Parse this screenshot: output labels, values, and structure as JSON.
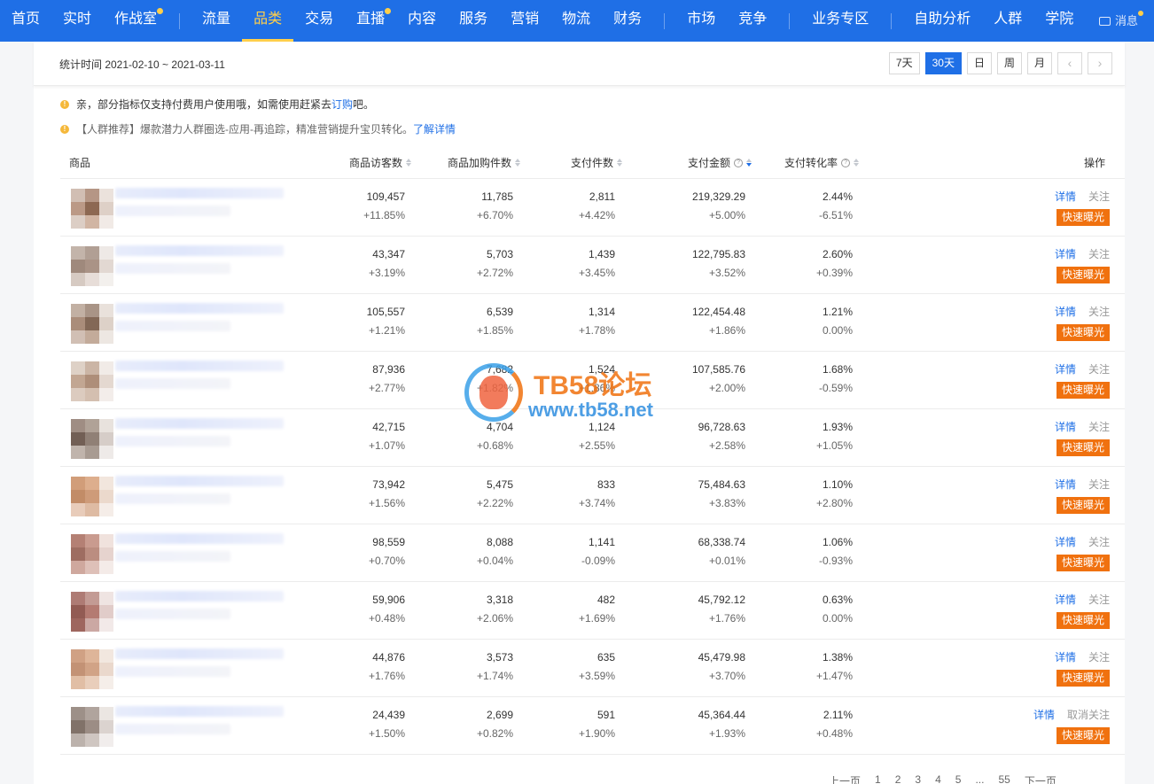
{
  "nav": {
    "items": [
      {
        "label": "首页",
        "dot": false,
        "active": false
      },
      {
        "label": "实时",
        "dot": false,
        "active": false
      },
      {
        "label": "作战室",
        "dot": true,
        "active": false
      },
      {
        "sep": true
      },
      {
        "label": "流量",
        "dot": false,
        "active": false
      },
      {
        "label": "品类",
        "dot": false,
        "active": true
      },
      {
        "label": "交易",
        "dot": false,
        "active": false
      },
      {
        "label": "直播",
        "dot": true,
        "active": false
      },
      {
        "label": "内容",
        "dot": false,
        "active": false
      },
      {
        "label": "服务",
        "dot": false,
        "active": false
      },
      {
        "label": "营销",
        "dot": false,
        "active": false
      },
      {
        "label": "物流",
        "dot": false,
        "active": false
      },
      {
        "label": "财务",
        "dot": false,
        "active": false
      },
      {
        "sep": true
      },
      {
        "label": "市场",
        "dot": false,
        "active": false
      },
      {
        "label": "竞争",
        "dot": false,
        "active": false
      },
      {
        "sep": true
      },
      {
        "label": "业务专区",
        "dot": false,
        "active": false
      },
      {
        "sep": true
      },
      {
        "label": "自助分析",
        "dot": false,
        "active": false
      },
      {
        "label": "人群",
        "dot": false,
        "active": false
      },
      {
        "label": "学院",
        "dot": false,
        "active": false
      }
    ],
    "message_label": "消息",
    "message_icon": "envelope-icon"
  },
  "stat": {
    "label": "统计时间 2021-02-10 ~ 2021-03-11",
    "ranges": [
      "7天",
      "30天",
      "日",
      "周",
      "月"
    ],
    "active_range": "30天",
    "prev_icon": "‹",
    "next_icon": "›"
  },
  "notices": {
    "n1_text": "亲，部分指标仅支持付费用户使用哦，如需使用赶紧去",
    "n1_link": "订购",
    "n1_tail": "吧。",
    "n2_text": "【人群推荐】爆款潜力人群圈选-应用-再追踪，精准营销提升宝贝转化。",
    "n2_link": "了解详情"
  },
  "table": {
    "headers": {
      "product": "商品",
      "visitors": "商品访客数",
      "cart": "商品加购件数",
      "paid_items": "支付件数",
      "paid_amount": "支付金额",
      "conversion": "支付转化率",
      "ops": "操作"
    },
    "op_detail": "详情",
    "op_expose": "快速曝光",
    "rows": [
      {
        "visitors": "109,457",
        "visitors_chg": "+11.85%",
        "cart": "11,785",
        "cart_chg": "+6.70%",
        "paid": "2,811",
        "paid_chg": "+4.42%",
        "amount": "219,329.29",
        "amount_chg": "+5.00%",
        "conv": "2.44%",
        "conv_chg": "-6.51%",
        "follow": "关注",
        "colors": [
          "#c9b3a6",
          "#a98470",
          "#e8ddd6",
          "#b08872",
          "#7a4e35",
          "#d9c8be",
          "#d6c6bb",
          "#c9a994",
          "#efe7e2"
        ]
      },
      {
        "visitors": "43,347",
        "visitors_chg": "+3.19%",
        "cart": "5,703",
        "cart_chg": "+2.72%",
        "paid": "1,439",
        "paid_chg": "+3.45%",
        "amount": "122,795.83",
        "amount_chg": "+3.52%",
        "conv": "2.60%",
        "conv_chg": "+0.39%",
        "follow": "关注",
        "colors": [
          "#b9a79c",
          "#a48f82",
          "#ece6e2",
          "#8f7566",
          "#9c8172",
          "#ddd2cb",
          "#cfc1b8",
          "#e3d8d2",
          "#f2eeeb"
        ]
      },
      {
        "visitors": "105,557",
        "visitors_chg": "+1.21%",
        "cart": "6,539",
        "cart_chg": "+1.85%",
        "paid": "1,314",
        "paid_chg": "+1.78%",
        "amount": "122,454.48",
        "amount_chg": "+1.86%",
        "conv": "1.21%",
        "conv_chg": "0.00%",
        "follow": "关注",
        "colors": [
          "#b8a393",
          "#9b8271",
          "#e6dcd5",
          "#9c7a63",
          "#6e4e39",
          "#d8c9bf",
          "#c9b5a7",
          "#b99d89",
          "#ebe3de"
        ]
      },
      {
        "visitors": "87,936",
        "visitors_chg": "+2.77%",
        "cart": "7,682",
        "cart_chg": "+1.82%",
        "paid": "1,524",
        "paid_chg": "+1.86%",
        "amount": "107,585.76",
        "amount_chg": "+2.00%",
        "conv": "1.68%",
        "conv_chg": "-0.59%",
        "follow": "关注",
        "colors": [
          "#d9c9bd",
          "#c3a996",
          "#efe8e3",
          "#b8977f",
          "#a07b62",
          "#e0d2c8",
          "#d6c3b5",
          "#cdb5a3",
          "#f1ebe7"
        ]
      },
      {
        "visitors": "42,715",
        "visitors_chg": "+1.07%",
        "cart": "4,704",
        "cart_chg": "+0.68%",
        "paid": "1,124",
        "paid_chg": "+2.55%",
        "amount": "96,728.63",
        "amount_chg": "+2.58%",
        "conv": "1.93%",
        "conv_chg": "+1.05%",
        "follow": "关注",
        "colors": [
          "#8f7a6e",
          "#a39286",
          "#e4ddd8",
          "#5a4438",
          "#7d6a5f",
          "#cfc5bf",
          "#b6a79e",
          "#9a8a80",
          "#ece7e4"
        ]
      },
      {
        "visitors": "73,942",
        "visitors_chg": "+1.56%",
        "cart": "5,475",
        "cart_chg": "+2.22%",
        "paid": "833",
        "paid_chg": "+3.74%",
        "amount": "75,484.63",
        "amount_chg": "+3.83%",
        "conv": "1.10%",
        "conv_chg": "+2.80%",
        "follow": "关注",
        "colors": [
          "#c98d62",
          "#d8a17a",
          "#f0e2d8",
          "#b8784d",
          "#c68a62",
          "#e8d3c4",
          "#e4c4ae",
          "#d9b093",
          "#f4ebe5"
        ]
      },
      {
        "visitors": "98,559",
        "visitors_chg": "+0.70%",
        "cart": "8,088",
        "cart_chg": "+0.04%",
        "paid": "1,141",
        "paid_chg": "-0.09%",
        "amount": "68,338.74",
        "amount_chg": "+0.01%",
        "conv": "1.06%",
        "conv_chg": "-0.93%",
        "follow": "关注",
        "colors": [
          "#a86a5c",
          "#c08a7c",
          "#eeddd8",
          "#8e5446",
          "#b07a6b",
          "#e2ccc6",
          "#c79a8e",
          "#d9b6ac",
          "#f3e8e5"
        ]
      },
      {
        "visitors": "59,906",
        "visitors_chg": "+0.48%",
        "cart": "3,318",
        "cart_chg": "+2.06%",
        "paid": "482",
        "paid_chg": "+1.69%",
        "amount": "45,792.12",
        "amount_chg": "+1.76%",
        "conv": "0.63%",
        "conv_chg": "0.00%",
        "follow": "关注",
        "colors": [
          "#a0655c",
          "#b98a82",
          "#ede0dd",
          "#7f3f36",
          "#a8645a",
          "#dcc4c0",
          "#8e4c43",
          "#c29a93",
          "#f0e6e4"
        ]
      },
      {
        "visitors": "44,876",
        "visitors_chg": "+1.76%",
        "cart": "3,573",
        "cart_chg": "+1.74%",
        "paid": "635",
        "paid_chg": "+3.59%",
        "amount": "45,479.98",
        "amount_chg": "+3.70%",
        "conv": "1.38%",
        "conv_chg": "+1.47%",
        "follow": "关注",
        "colors": [
          "#c8916f",
          "#d9a988",
          "#f0e3da",
          "#b9805d",
          "#c99372",
          "#e7d2c4",
          "#dcb396",
          "#e6c6b0",
          "#f4ece6"
        ]
      },
      {
        "visitors": "24,439",
        "visitors_chg": "+1.50%",
        "cart": "2,699",
        "cart_chg": "+0.82%",
        "paid": "591",
        "paid_chg": "+1.90%",
        "amount": "45,364.44",
        "amount_chg": "+1.93%",
        "conv": "2.11%",
        "conv_chg": "+0.48%",
        "follow": "取消关注",
        "colors": [
          "#8d7d74",
          "#a3958d",
          "#e8e2de",
          "#6c5a50",
          "#8b7a70",
          "#d5ccc7",
          "#b1a59e",
          "#c7bdb7",
          "#efebe9"
        ]
      }
    ]
  },
  "watermark": {
    "line1": "TB58论坛",
    "line2": "www.tb58.net"
  },
  "pager": {
    "items": [
      "上一页",
      "1",
      "2",
      "3",
      "4",
      "5",
      "...",
      "55",
      "下一页"
    ]
  }
}
